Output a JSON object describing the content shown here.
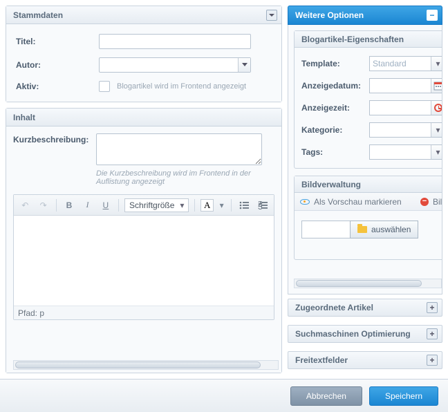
{
  "left": {
    "stammdaten": {
      "title": "Stammdaten",
      "titel_label": "Titel:",
      "autor_label": "Autor:",
      "aktiv_label": "Aktiv:",
      "aktiv_help": "Blogartikel wird im Frontend angezeigt"
    },
    "inhalt": {
      "title": "Inhalt",
      "kurz_label": "Kurzbeschreibung:",
      "kurz_help": "Die Kurzbeschreibung wird im Frontend in der Auflistung angezeigt",
      "font_size_label": "Schriftgröße",
      "path_label": "Pfad: p"
    }
  },
  "right": {
    "title": "Weitere Optionen",
    "props": {
      "title": "Blogartikel-Eigenschaften",
      "template_label": "Template:",
      "template_value": "Standard",
      "date_label": "Anzeigedatum:",
      "time_label": "Anzeigezeit:",
      "cat_label": "Kategorie:",
      "tags_label": "Tags:"
    },
    "bild": {
      "title": "Bildverwaltung",
      "preview_label": "Als Vorschau markieren",
      "delete_label": "Bild",
      "choose_label": "auswählen"
    },
    "accordion": {
      "a1": "Zugeordnete Artikel",
      "a2": "Suchmaschinen Optimierung",
      "a3": "Freitextfelder"
    }
  },
  "footer": {
    "cancel": "Abbrechen",
    "save": "Speichern"
  }
}
